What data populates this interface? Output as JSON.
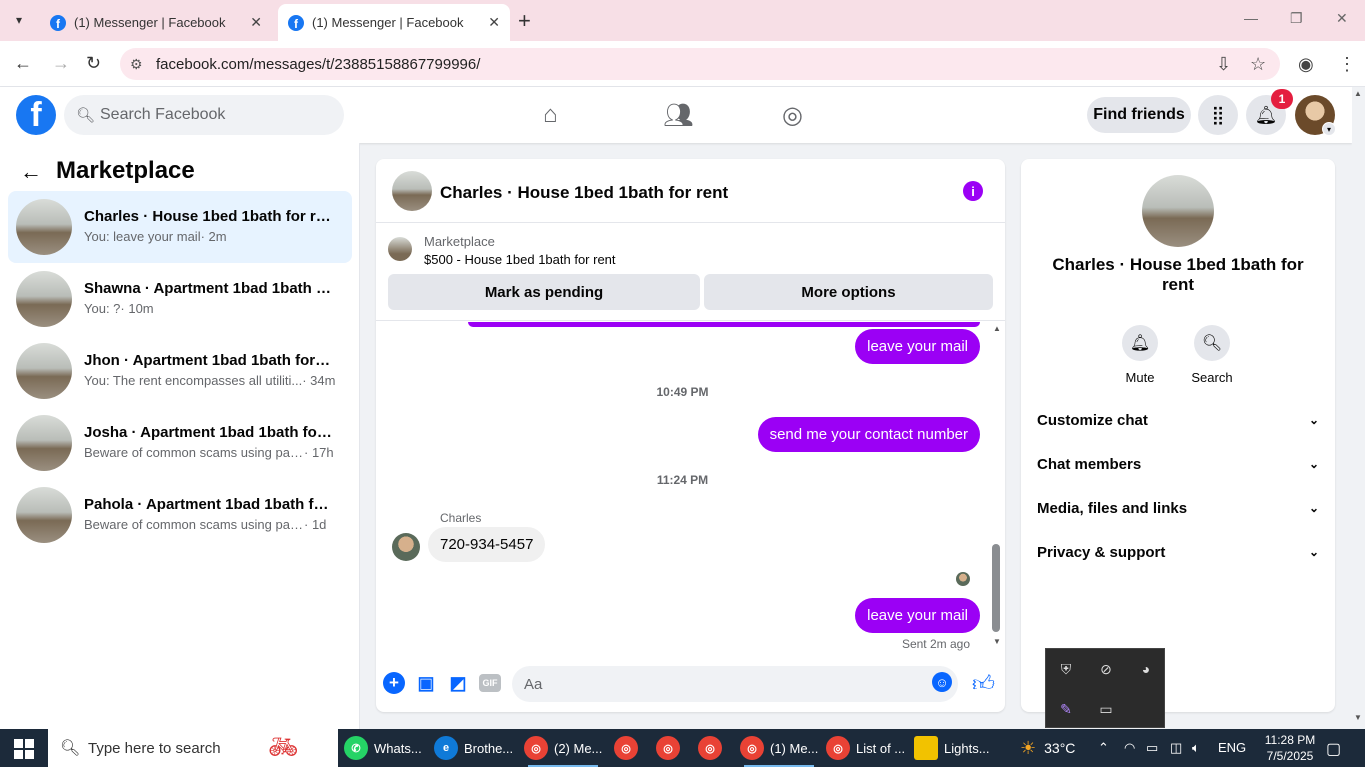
{
  "browser": {
    "tabs": [
      {
        "title": "(1) Messenger | Facebook",
        "active": false
      },
      {
        "title": "(1) Messenger | Facebook",
        "active": true
      }
    ],
    "url": "facebook.com/messages/t/23885158867799996/"
  },
  "fb_header": {
    "search_placeholder": "Search Facebook",
    "find_friends": "Find friends",
    "notification_count": "1"
  },
  "left_panel": {
    "title": "Marketplace",
    "conversations": [
      {
        "title": "Charles · House 1bed 1bath for rent",
        "subtitle": "You: leave your mail",
        "time": "· 2m",
        "active": true
      },
      {
        "title": "Shawna · Apartment 1bad 1bath fo...",
        "subtitle": "You: ?",
        "time": "· 10m",
        "active": false
      },
      {
        "title": "Jhon · Apartment 1bad 1bath for r...",
        "subtitle": "You: The rent encompasses all utiliti...",
        "time": "· 34m",
        "active": false
      },
      {
        "title": "Josha · Apartment 1bad 1bath for r...",
        "subtitle": "Beware of common scams using pay...",
        "time": "· 17h",
        "active": false
      },
      {
        "title": "Pahola · Apartment 1bad 1bath for...",
        "subtitle": "Beware of common scams using pay...",
        "time": "· 1d",
        "active": false
      }
    ]
  },
  "chat": {
    "header_name": "Charles · House 1bed 1bath for rent",
    "marketplace_label": "Marketplace",
    "listing": "$500 - House 1bed 1bath for rent",
    "mark_pending": "Mark as pending",
    "more_options": "More options",
    "messages": {
      "out_1": "leave your mail",
      "ts_1": "10:49 PM",
      "out_2": "send me your contact number",
      "ts_2": "11:24 PM",
      "sender": "Charles",
      "in_1": "720-934-5457",
      "out_3": "leave your mail",
      "status": "Sent 2m ago"
    },
    "composer_placeholder": "Aa"
  },
  "right_panel": {
    "name": "Charles · House 1bed 1bath for rent",
    "actions": [
      {
        "label": "Mute",
        "icon": "bell-icon"
      },
      {
        "label": "Search",
        "icon": "search-icon"
      }
    ],
    "sections": [
      "Customize chat",
      "Chat members",
      "Media, files and links",
      "Privacy & support"
    ]
  },
  "taskbar": {
    "search_placeholder": "Type here to search",
    "apps": [
      {
        "label": "Whats...",
        "color": "#25d366"
      },
      {
        "label": "Brothe...",
        "color": "#0f7ad8"
      },
      {
        "label": "(2) Me...",
        "color": "#e94235"
      },
      {
        "label": "",
        "color": "#e94235"
      },
      {
        "label": "",
        "color": "#e94235"
      },
      {
        "label": "",
        "color": "#e94235"
      },
      {
        "label": "(1) Me...",
        "color": "#e94235"
      },
      {
        "label": "List of ...",
        "color": "#e94235"
      },
      {
        "label": "Lights...",
        "color": "#f2c200"
      }
    ],
    "temperature": "33°C",
    "language": "ENG",
    "time": "11:28 PM",
    "date": "7/5/2025"
  },
  "colors": {
    "fb_blue": "#1877f2",
    "messenger_purple": "#9b00f5",
    "active_conv_bg": "#e7f3ff"
  }
}
